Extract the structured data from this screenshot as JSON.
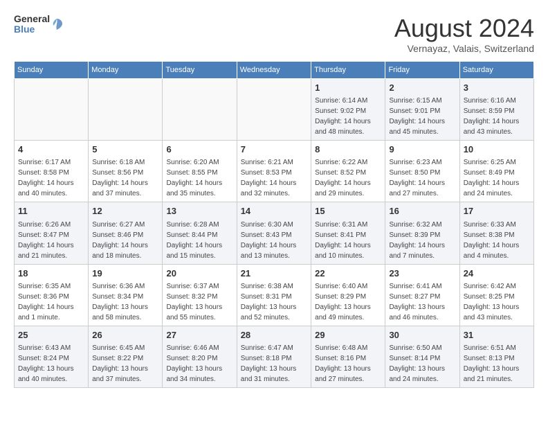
{
  "logo": {
    "line1": "General",
    "line2": "Blue"
  },
  "title": "August 2024",
  "location": "Vernayaz, Valais, Switzerland",
  "days_of_week": [
    "Sunday",
    "Monday",
    "Tuesday",
    "Wednesday",
    "Thursday",
    "Friday",
    "Saturday"
  ],
  "weeks": [
    [
      {
        "day": "",
        "info": ""
      },
      {
        "day": "",
        "info": ""
      },
      {
        "day": "",
        "info": ""
      },
      {
        "day": "",
        "info": ""
      },
      {
        "day": "1",
        "info": "Sunrise: 6:14 AM\nSunset: 9:02 PM\nDaylight: 14 hours\nand 48 minutes."
      },
      {
        "day": "2",
        "info": "Sunrise: 6:15 AM\nSunset: 9:01 PM\nDaylight: 14 hours\nand 45 minutes."
      },
      {
        "day": "3",
        "info": "Sunrise: 6:16 AM\nSunset: 8:59 PM\nDaylight: 14 hours\nand 43 minutes."
      }
    ],
    [
      {
        "day": "4",
        "info": "Sunrise: 6:17 AM\nSunset: 8:58 PM\nDaylight: 14 hours\nand 40 minutes."
      },
      {
        "day": "5",
        "info": "Sunrise: 6:18 AM\nSunset: 8:56 PM\nDaylight: 14 hours\nand 37 minutes."
      },
      {
        "day": "6",
        "info": "Sunrise: 6:20 AM\nSunset: 8:55 PM\nDaylight: 14 hours\nand 35 minutes."
      },
      {
        "day": "7",
        "info": "Sunrise: 6:21 AM\nSunset: 8:53 PM\nDaylight: 14 hours\nand 32 minutes."
      },
      {
        "day": "8",
        "info": "Sunrise: 6:22 AM\nSunset: 8:52 PM\nDaylight: 14 hours\nand 29 minutes."
      },
      {
        "day": "9",
        "info": "Sunrise: 6:23 AM\nSunset: 8:50 PM\nDaylight: 14 hours\nand 27 minutes."
      },
      {
        "day": "10",
        "info": "Sunrise: 6:25 AM\nSunset: 8:49 PM\nDaylight: 14 hours\nand 24 minutes."
      }
    ],
    [
      {
        "day": "11",
        "info": "Sunrise: 6:26 AM\nSunset: 8:47 PM\nDaylight: 14 hours\nand 21 minutes."
      },
      {
        "day": "12",
        "info": "Sunrise: 6:27 AM\nSunset: 8:46 PM\nDaylight: 14 hours\nand 18 minutes."
      },
      {
        "day": "13",
        "info": "Sunrise: 6:28 AM\nSunset: 8:44 PM\nDaylight: 14 hours\nand 15 minutes."
      },
      {
        "day": "14",
        "info": "Sunrise: 6:30 AM\nSunset: 8:43 PM\nDaylight: 14 hours\nand 13 minutes."
      },
      {
        "day": "15",
        "info": "Sunrise: 6:31 AM\nSunset: 8:41 PM\nDaylight: 14 hours\nand 10 minutes."
      },
      {
        "day": "16",
        "info": "Sunrise: 6:32 AM\nSunset: 8:39 PM\nDaylight: 14 hours\nand 7 minutes."
      },
      {
        "day": "17",
        "info": "Sunrise: 6:33 AM\nSunset: 8:38 PM\nDaylight: 14 hours\nand 4 minutes."
      }
    ],
    [
      {
        "day": "18",
        "info": "Sunrise: 6:35 AM\nSunset: 8:36 PM\nDaylight: 14 hours\nand 1 minute."
      },
      {
        "day": "19",
        "info": "Sunrise: 6:36 AM\nSunset: 8:34 PM\nDaylight: 13 hours\nand 58 minutes."
      },
      {
        "day": "20",
        "info": "Sunrise: 6:37 AM\nSunset: 8:32 PM\nDaylight: 13 hours\nand 55 minutes."
      },
      {
        "day": "21",
        "info": "Sunrise: 6:38 AM\nSunset: 8:31 PM\nDaylight: 13 hours\nand 52 minutes."
      },
      {
        "day": "22",
        "info": "Sunrise: 6:40 AM\nSunset: 8:29 PM\nDaylight: 13 hours\nand 49 minutes."
      },
      {
        "day": "23",
        "info": "Sunrise: 6:41 AM\nSunset: 8:27 PM\nDaylight: 13 hours\nand 46 minutes."
      },
      {
        "day": "24",
        "info": "Sunrise: 6:42 AM\nSunset: 8:25 PM\nDaylight: 13 hours\nand 43 minutes."
      }
    ],
    [
      {
        "day": "25",
        "info": "Sunrise: 6:43 AM\nSunset: 8:24 PM\nDaylight: 13 hours\nand 40 minutes."
      },
      {
        "day": "26",
        "info": "Sunrise: 6:45 AM\nSunset: 8:22 PM\nDaylight: 13 hours\nand 37 minutes."
      },
      {
        "day": "27",
        "info": "Sunrise: 6:46 AM\nSunset: 8:20 PM\nDaylight: 13 hours\nand 34 minutes."
      },
      {
        "day": "28",
        "info": "Sunrise: 6:47 AM\nSunset: 8:18 PM\nDaylight: 13 hours\nand 31 minutes."
      },
      {
        "day": "29",
        "info": "Sunrise: 6:48 AM\nSunset: 8:16 PM\nDaylight: 13 hours\nand 27 minutes."
      },
      {
        "day": "30",
        "info": "Sunrise: 6:50 AM\nSunset: 8:14 PM\nDaylight: 13 hours\nand 24 minutes."
      },
      {
        "day": "31",
        "info": "Sunrise: 6:51 AM\nSunset: 8:13 PM\nDaylight: 13 hours\nand 21 minutes."
      }
    ]
  ]
}
